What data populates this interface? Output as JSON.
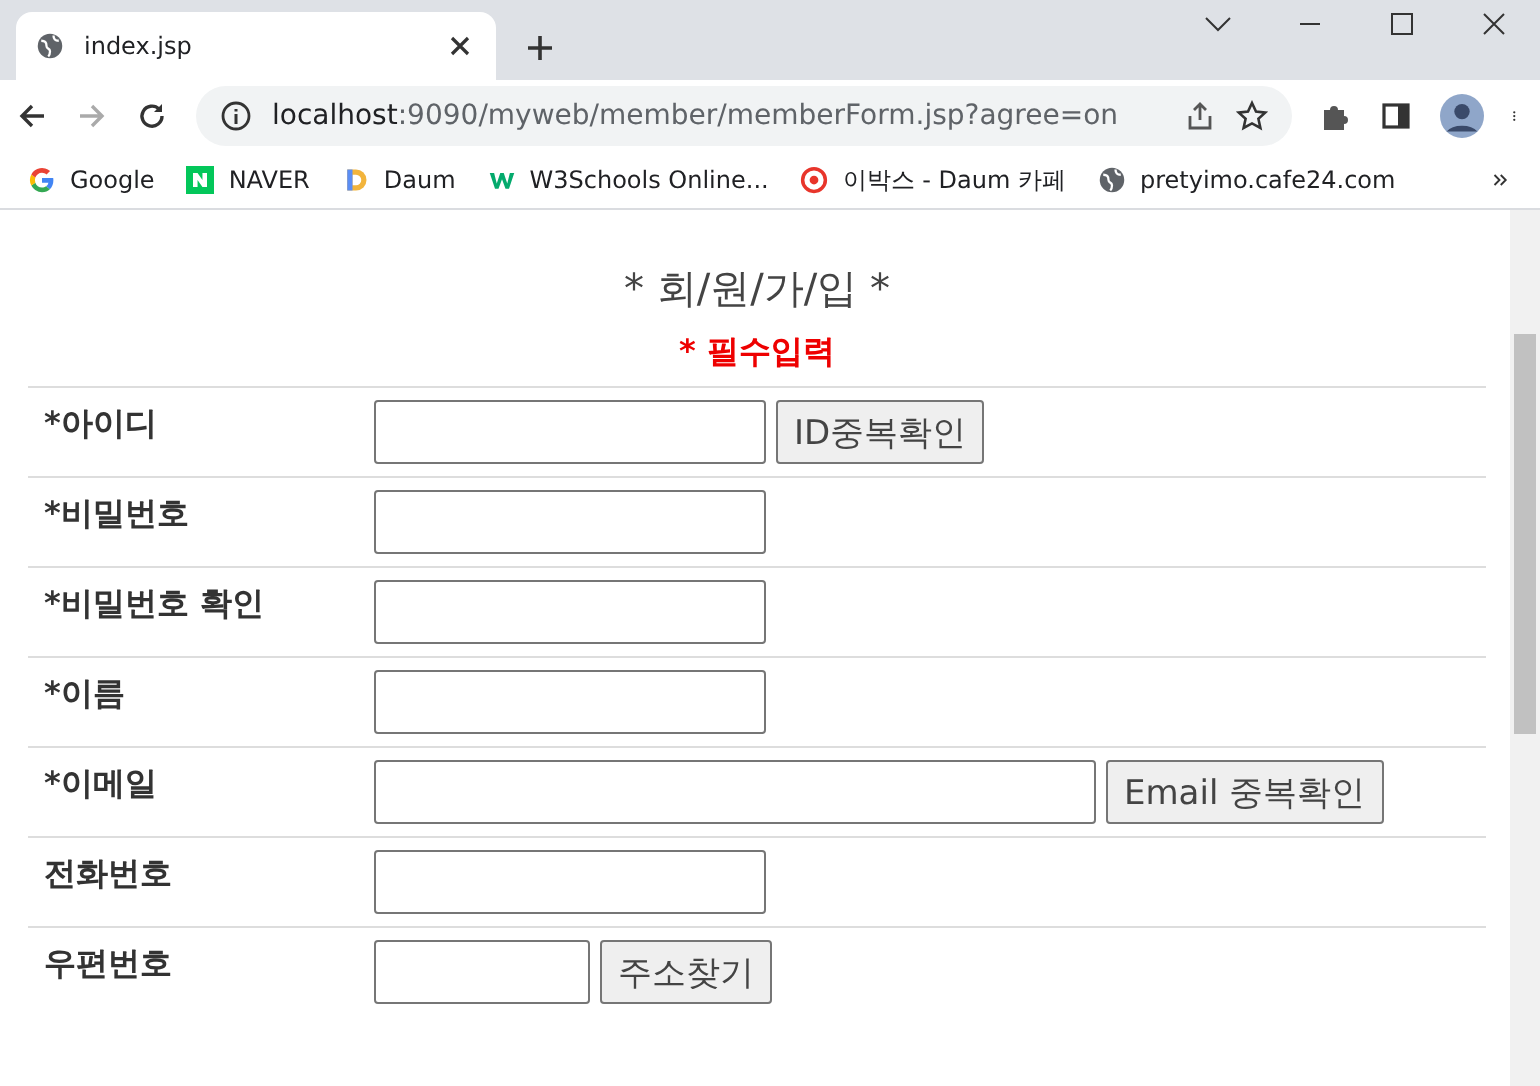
{
  "tab": {
    "title": "index.jsp"
  },
  "address_bar": {
    "host": "localhost",
    "path": ":9090/myweb/member/memberForm.jsp?agree=on"
  },
  "bookmarks": [
    {
      "label": "Google",
      "kind": "google"
    },
    {
      "label": "NAVER",
      "kind": "naver"
    },
    {
      "label": "Daum",
      "kind": "daum"
    },
    {
      "label": "W3Schools Online...",
      "kind": "w3"
    },
    {
      "label": "이박스 - Daum 카페",
      "kind": "cafe"
    },
    {
      "label": "pretyimo.cafe24.com",
      "kind": "globe"
    }
  ],
  "form": {
    "title": "* 회/원/가/입 *",
    "required_note": "* 필수입력",
    "rows": [
      {
        "label": "*아이디",
        "kind": "medium",
        "button": "ID중복확인"
      },
      {
        "label": "*비밀번호",
        "kind": "medium"
      },
      {
        "label": "*비밀번호 확인",
        "kind": "medium"
      },
      {
        "label": "*이름",
        "kind": "medium"
      },
      {
        "label": "*이메일",
        "kind": "long",
        "button": "Email 중복확인"
      },
      {
        "label": "전화번호",
        "kind": "medium"
      },
      {
        "label": "우편번호",
        "kind": "short",
        "button": "주소찾기"
      }
    ]
  }
}
